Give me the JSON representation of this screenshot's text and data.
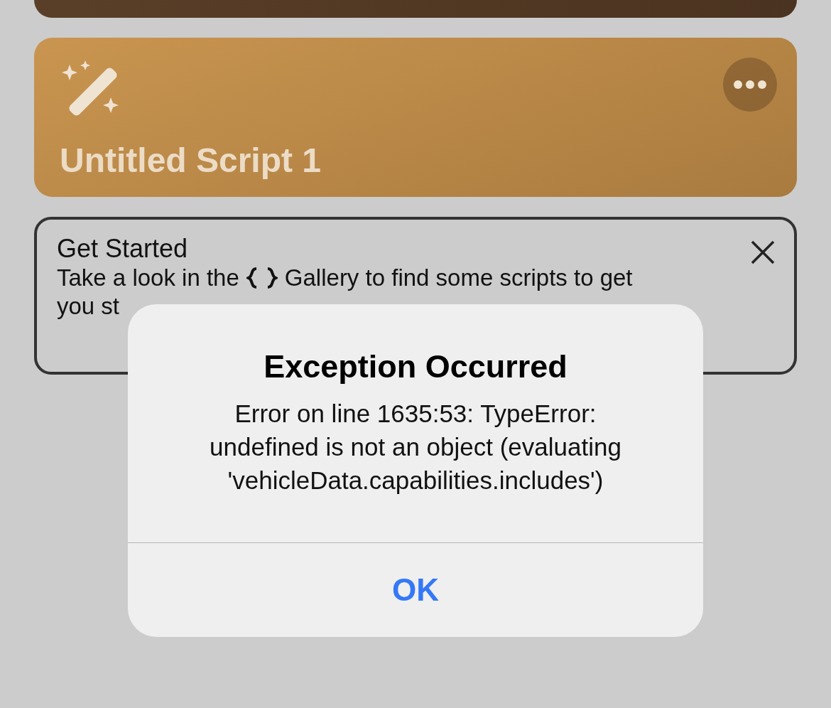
{
  "script_card": {
    "title": "Untitled Script 1"
  },
  "get_started": {
    "title": "Get Started",
    "line_1_before": "Take a look in the",
    "line_1_after": "Gallery to find some scripts to get",
    "line_2": "you st"
  },
  "alert": {
    "title": "Exception Occurred",
    "message": "Error on line 1635:53: TypeError: undefined is not an object (evaluating 'vehicleData.capabilities.includes')",
    "buttons": [
      "OK"
    ]
  }
}
